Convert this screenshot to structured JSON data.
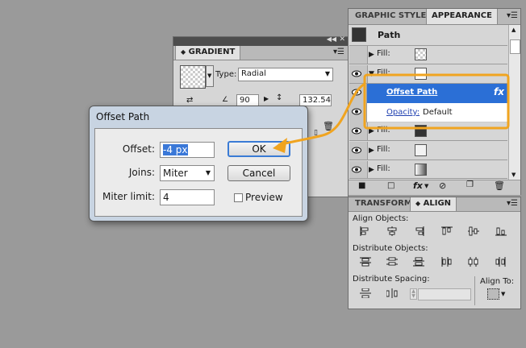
{
  "appearance_panel": {
    "tabs": [
      "GRAPHIC STYLES",
      "APPEARANCE"
    ],
    "object_type": "Path",
    "fill_label": "Fill:",
    "effect_name": "Offset Path",
    "fx_label": "fx",
    "opacity_label": "Opacity:",
    "opacity_value": "Default",
    "colors": {
      "highlight": "#2b6fd6",
      "annotation": "#f0a420"
    }
  },
  "gradient_panel": {
    "title": "GRADIENT",
    "type_label": "Type:",
    "type_value": "Radial",
    "angle_value": "90",
    "ratio_value": "132.54"
  },
  "align_panel": {
    "tabs": [
      "TRANSFORM",
      "ALIGN"
    ],
    "align_objects_label": "Align Objects:",
    "distribute_objects_label": "Distribute Objects:",
    "distribute_spacing_label": "Distribute Spacing:",
    "align_to_label": "Align To:"
  },
  "dialog": {
    "title": "Offset Path",
    "offset_label": "Offset:",
    "offset_value": "-4 px",
    "joins_label": "Joins:",
    "joins_value": "Miter",
    "miter_label": "Miter limit:",
    "miter_value": "4",
    "ok_label": "OK",
    "cancel_label": "Cancel",
    "preview_label": "Preview"
  }
}
